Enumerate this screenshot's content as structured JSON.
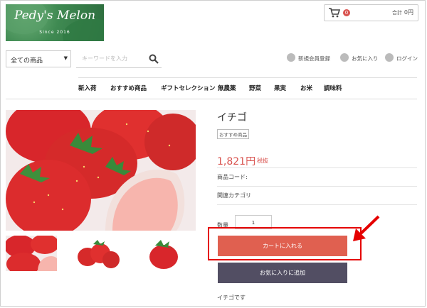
{
  "logo": {
    "title": "Pedy's Melon",
    "since": "Since 2016"
  },
  "cart": {
    "count": "0",
    "total_label": "合計",
    "total_value": "0円"
  },
  "search": {
    "category": "全ての商品",
    "placeholder": "キーワードを入力"
  },
  "account_links": {
    "register": "新規会員登録",
    "favorites": "お気に入り",
    "login": "ログイン"
  },
  "nav": {
    "items": [
      "新入荷",
      "おすすめ商品",
      "ギフトセレクション",
      "無農薬",
      "野菜",
      "果実",
      "お米",
      "調味料"
    ]
  },
  "product": {
    "title": "イチゴ",
    "tag": "おすすめ商品",
    "price": "1,821円",
    "tax": "税抜",
    "code_label": "商品コード:",
    "category_label": "関連カテゴリ",
    "qty_label": "数量",
    "qty_value": "1",
    "add_to_cart": "カートに入れる",
    "add_to_favorites": "お気に入りに追加",
    "description": "イチゴです"
  },
  "colors": {
    "accent": "#e06050",
    "dark_button": "#524e63",
    "price": "#d9534f",
    "highlight": "#e50000"
  }
}
